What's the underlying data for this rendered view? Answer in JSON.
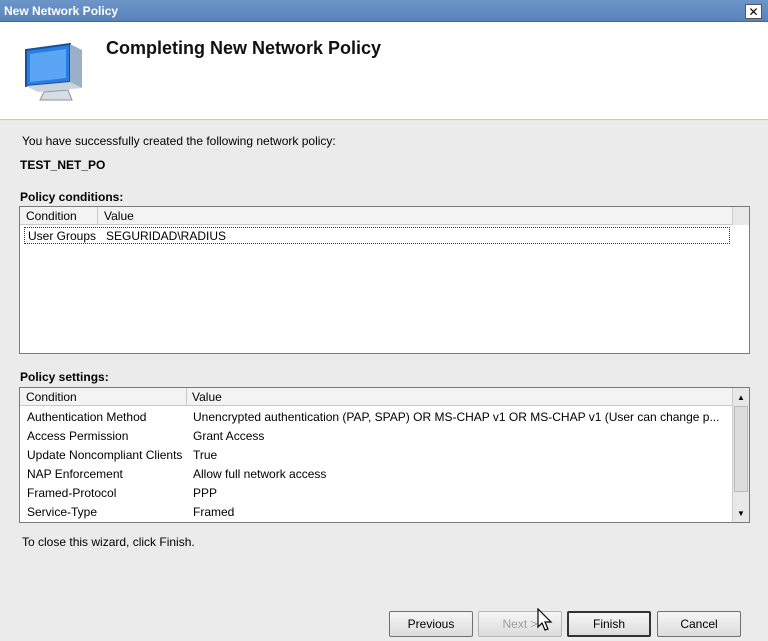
{
  "window": {
    "title": "New Network Policy",
    "close_label": "✕"
  },
  "header": {
    "heading": "Completing New Network Policy",
    "icon": "computer-monitor-icon"
  },
  "intro_text": "You have successfully created the following network policy:",
  "policy_name": "TEST_NET_PO",
  "conditions": {
    "label": "Policy conditions:",
    "columns": [
      "Condition",
      "Value"
    ],
    "rows": [
      {
        "condition": "User Groups",
        "value": "SEGURIDAD\\RADIUS"
      }
    ]
  },
  "settings": {
    "label": "Policy settings:",
    "columns": [
      "Condition",
      "Value"
    ],
    "rows": [
      {
        "condition": "Authentication Method",
        "value": "Unencrypted authentication (PAP, SPAP) OR MS-CHAP v1 OR MS-CHAP v1 (User can change p..."
      },
      {
        "condition": "Access Permission",
        "value": "Grant Access"
      },
      {
        "condition": "Update Noncompliant Clients",
        "value": "True"
      },
      {
        "condition": "NAP Enforcement",
        "value": "Allow full network access"
      },
      {
        "condition": "Framed-Protocol",
        "value": "PPP"
      },
      {
        "condition": "Service-Type",
        "value": "Framed"
      }
    ]
  },
  "footer_hint": "To close this wizard, click Finish.",
  "buttons": {
    "previous": "Previous",
    "next": "Next >",
    "finish": "Finish",
    "cancel": "Cancel"
  },
  "scroll": {
    "up": "▲",
    "down": "▼"
  }
}
